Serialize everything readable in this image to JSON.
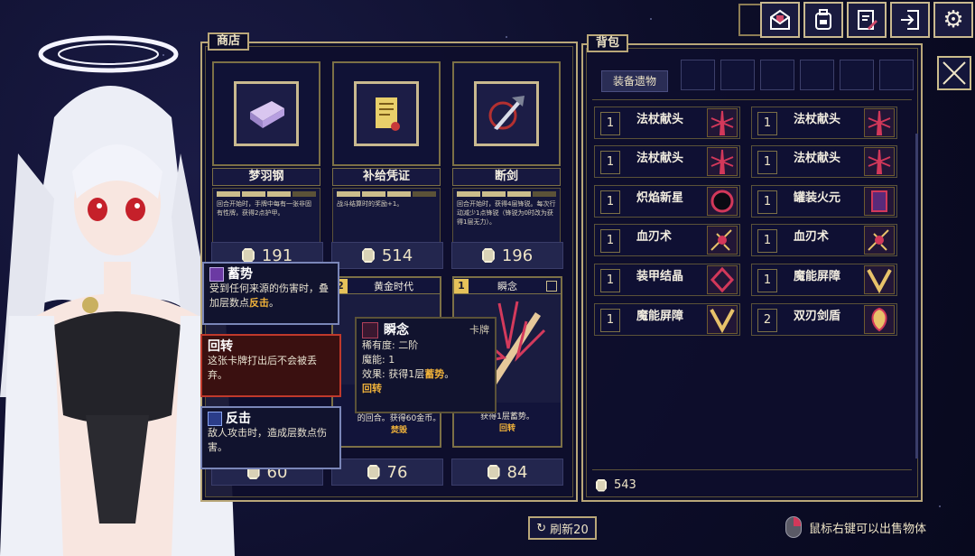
{
  "shop": {
    "title": "商店",
    "items": [
      {
        "name": "梦羽钢",
        "desc": "回合开始时，手牌中每有一张非固有性牌，获得2点护甲。",
        "price": "191",
        "progress": 3
      },
      {
        "name": "补给凭证",
        "desc": "战斗结算时的奖励+1。",
        "price": "514",
        "progress": 3
      },
      {
        "name": "断剑",
        "desc": "回合开始时，获得4层锋锐。每次行动减少1点锋锐（锋锐为0时改为获得1层无力）。",
        "price": "196",
        "progress": 3
      }
    ],
    "cards": [
      {
        "cost": "2",
        "name": "黄金时代",
        "desc": "的回合。获得60金币。",
        "keyword": "焚毁",
        "price": "76"
      },
      {
        "cost": "1",
        "name": "瞬念",
        "desc": "获得1层蓄势。",
        "keyword": "回转",
        "price": "84"
      }
    ],
    "left_price": "60",
    "refresh_label": "刷新20"
  },
  "backpack": {
    "title": "背包",
    "equip_relics_label": "装备遗物",
    "relic_slots": 6,
    "items": [
      {
        "count": "1",
        "name": "法杖献头"
      },
      {
        "count": "1",
        "name": "法杖献头"
      },
      {
        "count": "1",
        "name": "法杖献头"
      },
      {
        "count": "1",
        "name": "法杖献头"
      },
      {
        "count": "1",
        "name": "炽焰新星"
      },
      {
        "count": "1",
        "name": "罐装火元"
      },
      {
        "count": "1",
        "name": "血刃术"
      },
      {
        "count": "1",
        "name": "血刃术"
      },
      {
        "count": "1",
        "name": "装甲结晶"
      },
      {
        "count": "1",
        "name": "魔能屏障"
      },
      {
        "count": "1",
        "name": "魔能屏障"
      },
      {
        "count": "2",
        "name": "双刃剑盾"
      }
    ],
    "gold": "543"
  },
  "hint": "鼠标右键可以出售物体",
  "keywords": [
    {
      "title": "蓄势",
      "text_pre": "受到任何来源的伤害时，叠加层数点",
      "kw": "反击",
      "text_post": "。"
    },
    {
      "title": "回转",
      "text": "这张卡牌打出后不会被丢弃。"
    },
    {
      "title": "反击",
      "text": "敌人攻击时，造成层数点伤害。"
    }
  ],
  "card_tooltip": {
    "title": "瞬念",
    "type": "卡牌",
    "rarity": "稀有度: 二阶",
    "cost": "魔能: 1",
    "effect_pre": "效果: 获得1层",
    "effect_kw": "蓄势",
    "effect_post": "。",
    "keyword": "回转"
  },
  "toolbar": [
    "mail-icon",
    "backpack-icon",
    "notes-icon",
    "exit-icon",
    "gear-icon"
  ],
  "colors": {
    "gold": "#b9a779",
    "accent_orange": "#f0b23a",
    "highlight_red": "#c0392b",
    "bg": "#0d0e2a"
  }
}
